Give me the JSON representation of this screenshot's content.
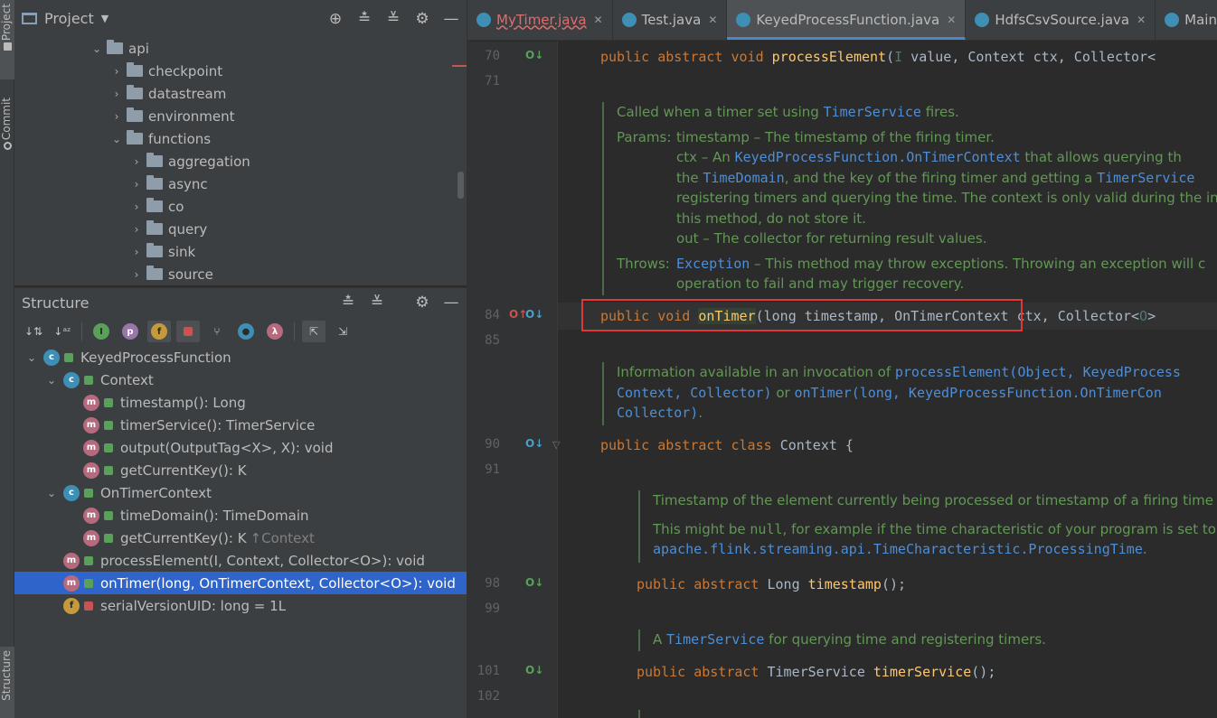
{
  "left_strip": {
    "project_tab": "Project",
    "commit_tab": "Commit",
    "structure_tab": "Structure"
  },
  "project": {
    "title": "Project",
    "items": [
      {
        "label": "api",
        "indent": 4,
        "expanded": true
      },
      {
        "label": "checkpoint",
        "indent": 5,
        "expanded": false
      },
      {
        "label": "datastream",
        "indent": 5,
        "expanded": false
      },
      {
        "label": "environment",
        "indent": 5,
        "expanded": false
      },
      {
        "label": "functions",
        "indent": 5,
        "expanded": true
      },
      {
        "label": "aggregation",
        "indent": 6,
        "expanded": false
      },
      {
        "label": "async",
        "indent": 6,
        "expanded": false
      },
      {
        "label": "co",
        "indent": 6,
        "expanded": false
      },
      {
        "label": "query",
        "indent": 6,
        "expanded": false
      },
      {
        "label": "sink",
        "indent": 6,
        "expanded": false
      },
      {
        "label": "source",
        "indent": 6,
        "expanded": false
      }
    ]
  },
  "structure": {
    "title": "Structure",
    "items": [
      {
        "label": "KeyedProcessFunction",
        "indent": 0,
        "icon": "c",
        "arrow": "down"
      },
      {
        "label": "Context",
        "indent": 1,
        "icon": "c",
        "arrow": "down"
      },
      {
        "label": "timestamp(): Long",
        "indent": 2,
        "icon": "m"
      },
      {
        "label": "timerService(): TimerService",
        "indent": 2,
        "icon": "m"
      },
      {
        "label": "output(OutputTag<X>, X): void",
        "indent": 2,
        "icon": "m"
      },
      {
        "label": "getCurrentKey(): K",
        "indent": 2,
        "icon": "m"
      },
      {
        "label": "OnTimerContext",
        "indent": 1,
        "icon": "c",
        "arrow": "down"
      },
      {
        "label": "timeDomain(): TimeDomain",
        "indent": 2,
        "icon": "m"
      },
      {
        "label": "getCurrentKey(): K",
        "indent": 2,
        "icon": "m",
        "suffix": "↑Context"
      },
      {
        "label": "processElement(I, Context, Collector<O>): void",
        "indent": 1,
        "icon": "m"
      },
      {
        "label": "onTimer(long, OnTimerContext, Collector<O>): void",
        "indent": 1,
        "icon": "m",
        "selected": true
      },
      {
        "label": "serialVersionUID: long = 1L",
        "indent": 1,
        "icon": "f",
        "lock": "red"
      }
    ]
  },
  "tabs": [
    {
      "label": "MyTimer.java",
      "error": true
    },
    {
      "label": "Test.java"
    },
    {
      "label": "KeyedProcessFunction.java",
      "active": true
    },
    {
      "label": "HdfsCsvSource.java"
    },
    {
      "label": "Main.ja"
    }
  ],
  "line_numbers": {
    "l70": "70",
    "l71": "71",
    "l84": "84",
    "l85": "85",
    "l90": "90",
    "l91": "91",
    "l98": "98",
    "l99": "99",
    "l101": "101",
    "l102": "102"
  },
  "code": {
    "l70": {
      "kw": "public abstract void ",
      "fn": "processElement",
      "p1": "(",
      "tp": "I",
      "rest": " value, Context ctx, Collector<"
    },
    "l84": {
      "kw": "public void ",
      "fn": "onTimer",
      "rest": "(long timestamp, OnTimerContext ctx, Collector<",
      "tp": "O",
      "end": ">"
    },
    "l90": {
      "kw": "public abstract class ",
      "rest": "Context {"
    },
    "l98": {
      "kw": "public abstract ",
      "rest1": "Long ",
      "fn": "timestamp",
      "rest2": "();"
    },
    "l101": {
      "kw": "public abstract ",
      "rest1": "TimerService ",
      "fn": "timerService",
      "rest2": "();"
    }
  },
  "doc_ontimer": {
    "line1_a": "Called when a timer set using ",
    "line1_link": "TimerService",
    "line1_b": " fires.",
    "params_label": "Params:",
    "p1": "timestamp – The timestamp of the firing timer.",
    "p2_a": "ctx – An ",
    "p2_link": "KeyedProcessFunction.OnTimerContext",
    "p2_b": " that allows querying th",
    "p3_a": "the ",
    "p3_link": "TimeDomain",
    "p3_b": ", and the key of the firing timer and getting a ",
    "p3_link2": "TimerService",
    "p4": "registering timers and querying the time. The context is only valid during the in",
    "p5": "this method, do not store it.",
    "p6": "out – The collector for returning result values.",
    "throws_label": "Throws:",
    "t1_link": "Exception",
    "t1_b": " – This method may throw exceptions. Throwing an exception will c",
    "t2": "operation to fail and may trigger recovery."
  },
  "doc_context": {
    "a": "Information available in an invocation of ",
    "link1": "processElement(Object, KeyedProcess",
    "link2": "Context, Collector)",
    "b": " or ",
    "link3": "onTimer(long, KeyedProcessFunction.OnTimerCon",
    "link4": "Collector)",
    "c": "."
  },
  "doc_timestamp": {
    "line1": "Timestamp of the element currently being processed or timestamp of a firing time",
    "line2_a": "This might be ",
    "line2_mono": "null",
    "line2_b": ", for example if the time characteristic of your program is set to",
    "line3_link": "apache.flink.streaming.api.TimeCharacteristic.ProcessingTime",
    "line3_b": "."
  },
  "doc_timerservice": {
    "a": "A ",
    "link": "TimerService",
    "b": " for querying time and registering timers."
  }
}
